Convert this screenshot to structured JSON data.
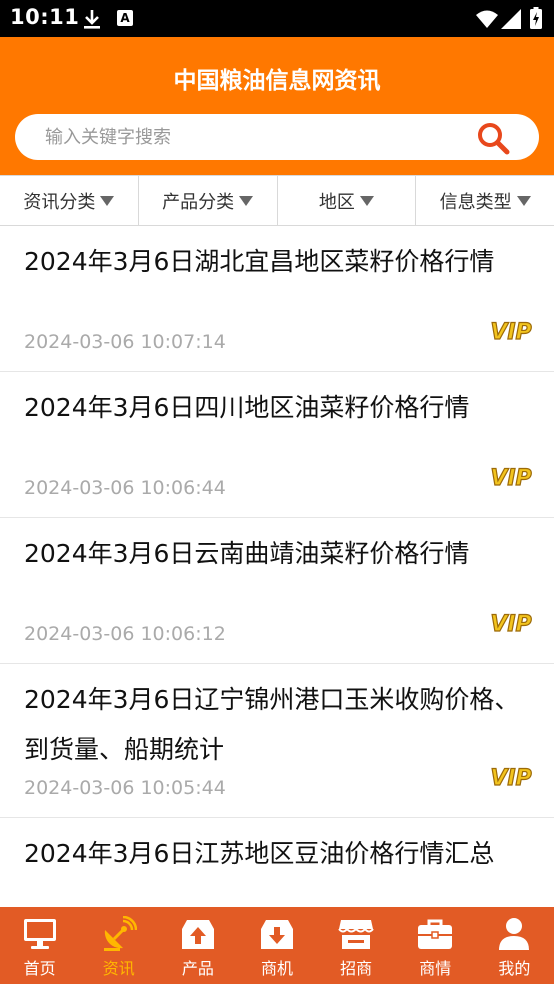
{
  "status_bar": {
    "time": "10:11",
    "a_badge": "A"
  },
  "header": {
    "title": "中国粮油信息网资讯"
  },
  "search": {
    "placeholder": "输入关键字搜索"
  },
  "filters": [
    {
      "label": "资讯分类"
    },
    {
      "label": "产品分类"
    },
    {
      "label": "地区"
    },
    {
      "label": "信息类型"
    }
  ],
  "news": [
    {
      "title": "2024年3月6日湖北宜昌地区菜籽价格行情",
      "time": "2024-03-06 10:07:14",
      "badge": "VIP"
    },
    {
      "title": "2024年3月6日四川地区油菜籽价格行情",
      "time": "2024-03-06 10:06:44",
      "badge": "VIP"
    },
    {
      "title": "2024年3月6日云南曲靖油菜籽价格行情",
      "time": "2024-03-06 10:06:12",
      "badge": "VIP"
    },
    {
      "title": "2024年3月6日辽宁锦州港口玉米收购价格、到货量、船期统计",
      "time": "2024-03-06 10:05:44",
      "badge": "VIP"
    },
    {
      "title": "2024年3月6日江苏地区豆油价格行情汇总",
      "time": "",
      "badge": ""
    }
  ],
  "tabs": [
    {
      "label": "首页",
      "icon": "monitor-icon"
    },
    {
      "label": "资讯",
      "icon": "satellite-dish-icon"
    },
    {
      "label": "产品",
      "icon": "box-upload-icon"
    },
    {
      "label": "商机",
      "icon": "box-download-icon"
    },
    {
      "label": "招商",
      "icon": "storefront-icon"
    },
    {
      "label": "商情",
      "icon": "briefcase-icon"
    },
    {
      "label": "我的",
      "icon": "user-icon"
    }
  ],
  "colors": {
    "primary": "#ff7800",
    "tabbar": "#e25b25",
    "active_tab": "#ffb700",
    "vip": "#e8b818"
  },
  "active_tab_index": 1
}
